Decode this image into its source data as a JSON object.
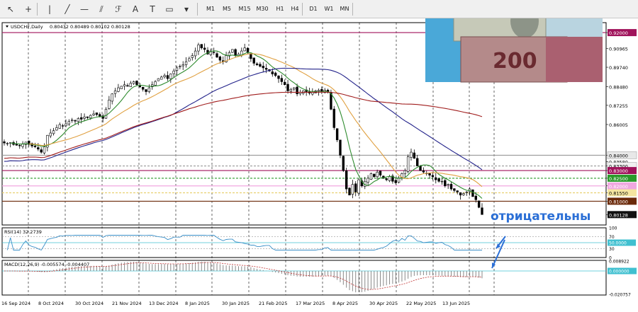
{
  "toolbar": {
    "tools": [
      "cursor-icon",
      "crosshair-icon",
      "vertical-line-icon",
      "trendline-icon",
      "horizontal-line-icon",
      "channel-icon",
      "fibonacci-icon",
      "text-icon",
      "label-icon",
      "rectangle-icon",
      "shapes-icon"
    ],
    "tool_glyphs": [
      "↖",
      "+",
      "|",
      "╱",
      "—",
      "⫽",
      "ℱ",
      "A",
      "T",
      "▭",
      "▾"
    ],
    "timeframes": [
      "M1",
      "M5",
      "M15",
      "M30",
      "H1",
      "H4",
      "D1",
      "W1",
      "MN"
    ]
  },
  "chart": {
    "symbol_label": "USDCHF,Daily",
    "ohlc": "0.80432 0.80489 0.80102 0.80128",
    "annotation": "отрицательны",
    "current_price_label": "0.80128",
    "price_axis": [
      {
        "label": "0.92000",
        "price": 0.92,
        "highlight": "#a0135b"
      },
      {
        "label": "0.90965",
        "price": 0.90965
      },
      {
        "label": "0.89740",
        "price": 0.8974
      },
      {
        "label": "0.88480",
        "price": 0.8848
      },
      {
        "label": "0.87255",
        "price": 0.87255
      },
      {
        "label": "0.86005",
        "price": 0.86005
      },
      {
        "label": "0.84000",
        "price": 0.84,
        "highlight": "#e8e8e8",
        "text_color": "#000"
      },
      {
        "label": "0.83580",
        "price": 0.8358
      },
      {
        "label": "0.83300",
        "price": 0.833,
        "highlight": "#f0f0f0",
        "text_color": "#000"
      },
      {
        "label": "0.83000",
        "price": 0.83,
        "highlight": "#a0135b"
      },
      {
        "label": "0.82500",
        "price": 0.825,
        "highlight": "#2a9a2a"
      },
      {
        "label": "0.82000",
        "price": 0.82,
        "highlight": "#f0a8e0"
      },
      {
        "label": "0.81550",
        "price": 0.8155,
        "highlight": "#f5e6a0",
        "text_color": "#000"
      },
      {
        "label": "0.81000",
        "price": 0.81,
        "highlight": "#6b2a0a"
      },
      {
        "label": "0.80128",
        "price": 0.80128,
        "highlight": "#111"
      }
    ],
    "levels": [
      {
        "price": 0.92,
        "color": "#a0135b",
        "style": "solid"
      },
      {
        "price": 0.84,
        "color": "#999999",
        "style": "solid"
      },
      {
        "price": 0.833,
        "color": "#999999",
        "style": "dashed"
      },
      {
        "price": 0.83,
        "color": "#a0135b",
        "style": "solid"
      },
      {
        "price": 0.825,
        "color": "#2a9a2a",
        "style": "dashed"
      },
      {
        "price": 0.82,
        "color": "#f0a8e0",
        "style": "solid"
      },
      {
        "price": 0.8155,
        "color": "#e8d070",
        "style": "dashed"
      },
      {
        "price": 0.81,
        "color": "#6b2a0a",
        "style": "solid"
      }
    ],
    "date_labels": [
      "16 Sep 2024",
      "8 Oct 2024",
      "30 Oct 2024",
      "21 Nov 2024",
      "13 Dec 2024",
      "8 Jan 2025",
      "30 Jan 2025",
      "21 Feb 2025",
      "17 Mar 2025",
      "8 Apr 2025",
      "30 Apr 2025",
      "22 May 2025",
      "13 Jun 2025"
    ],
    "closes": [
      0.848,
      0.8478,
      0.8482,
      0.847,
      0.8465,
      0.8462,
      0.8475,
      0.8486,
      0.847,
      0.846,
      0.8455,
      0.844,
      0.842,
      0.8455,
      0.853,
      0.8545,
      0.856,
      0.858,
      0.86,
      0.859,
      0.8605,
      0.862,
      0.863,
      0.8625,
      0.864,
      0.8635,
      0.865,
      0.8645,
      0.866,
      0.867,
      0.8665,
      0.865,
      0.864,
      0.87,
      0.876,
      0.88,
      0.882,
      0.884,
      0.885,
      0.886,
      0.885,
      0.887,
      0.888,
      0.886,
      0.8845,
      0.883,
      0.8815,
      0.884,
      0.886,
      0.888,
      0.89,
      0.891,
      0.892,
      0.89,
      0.893,
      0.895,
      0.897,
      0.898,
      0.899,
      0.901,
      0.903,
      0.905,
      0.908,
      0.912,
      0.91,
      0.909,
      0.906,
      0.908,
      0.907,
      0.904,
      0.902,
      0.901,
      0.905,
      0.907,
      0.909,
      0.905,
      0.906,
      0.908,
      0.91,
      0.907,
      0.903,
      0.9,
      0.899,
      0.898,
      0.897,
      0.896,
      0.895,
      0.893,
      0.892,
      0.89,
      0.888,
      0.886,
      0.882,
      0.883,
      0.884,
      0.88,
      0.881,
      0.882,
      0.8815,
      0.8805,
      0.881,
      0.882,
      0.8825,
      0.8815,
      0.8825,
      0.881,
      0.87,
      0.858,
      0.85,
      0.84,
      0.83,
      0.818,
      0.814,
      0.821,
      0.816,
      0.824,
      0.82,
      0.823,
      0.825,
      0.828,
      0.826,
      0.829,
      0.827,
      0.825,
      0.824,
      0.826,
      0.823,
      0.822,
      0.825,
      0.828,
      0.83,
      0.839,
      0.842,
      0.838,
      0.833,
      0.83,
      0.829,
      0.828,
      0.827,
      0.826,
      0.824,
      0.823,
      0.823,
      0.82,
      0.821,
      0.818,
      0.817,
      0.816,
      0.814,
      0.815,
      0.816,
      0.818,
      0.813,
      0.811,
      0.806,
      0.8013
    ],
    "rsi": {
      "label": "RSI(14) 32.2739",
      "levels": [
        {
          "label": "100",
          "value": 100
        },
        {
          "label": "70",
          "value": 70
        },
        {
          "label": "50.0000",
          "value": 50,
          "highlight": true
        },
        {
          "label": "30",
          "value": 30
        },
        {
          "label": "0",
          "value": 0
        }
      ]
    },
    "macd": {
      "label": "MACD(12,26,9) -0.005574 -0.004407",
      "axis": [
        {
          "label": "0.008922",
          "value": 0.008922
        },
        {
          "label": "0.000000",
          "value": 0,
          "highlight": true
        },
        {
          "label": "-0.020757",
          "value": -0.020757
        }
      ]
    }
  }
}
